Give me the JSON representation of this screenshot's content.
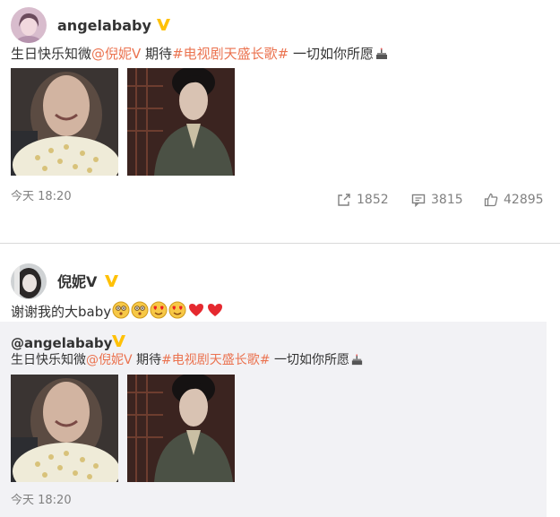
{
  "post1": {
    "username": "angelababy",
    "verified": true,
    "text_pre": "生日快乐知微",
    "mention": "@倪妮V",
    "text_mid": " 期待",
    "hashtag": "#电视剧天盛长歌#",
    "text_post": " 一切如你所愿",
    "cake_icon": "birthday-cake-icon",
    "time": "今天 18:20",
    "actions": {
      "share": "1852",
      "comment": "3815",
      "like": "42895"
    }
  },
  "post2": {
    "username": "倪妮V",
    "verified": true,
    "text": "谢谢我的大baby",
    "emojis": [
      "shy-face-icon",
      "shy-face-icon",
      "heart-eyes-icon",
      "heart-eyes-icon",
      "heart-icon",
      "heart-icon"
    ],
    "quoted": {
      "username": "@angelababy",
      "text_pre": "生日快乐知微",
      "mention": "@倪妮V",
      "text_mid": " 期待",
      "hashtag": "#电视剧天盛长歌#",
      "text_post": " 一切如你所愿",
      "time": "今天 18:20"
    }
  },
  "colors": {
    "link": "#eb7350",
    "verified_badge": "#ffc107",
    "quote_bg": "#f2f2f5"
  }
}
